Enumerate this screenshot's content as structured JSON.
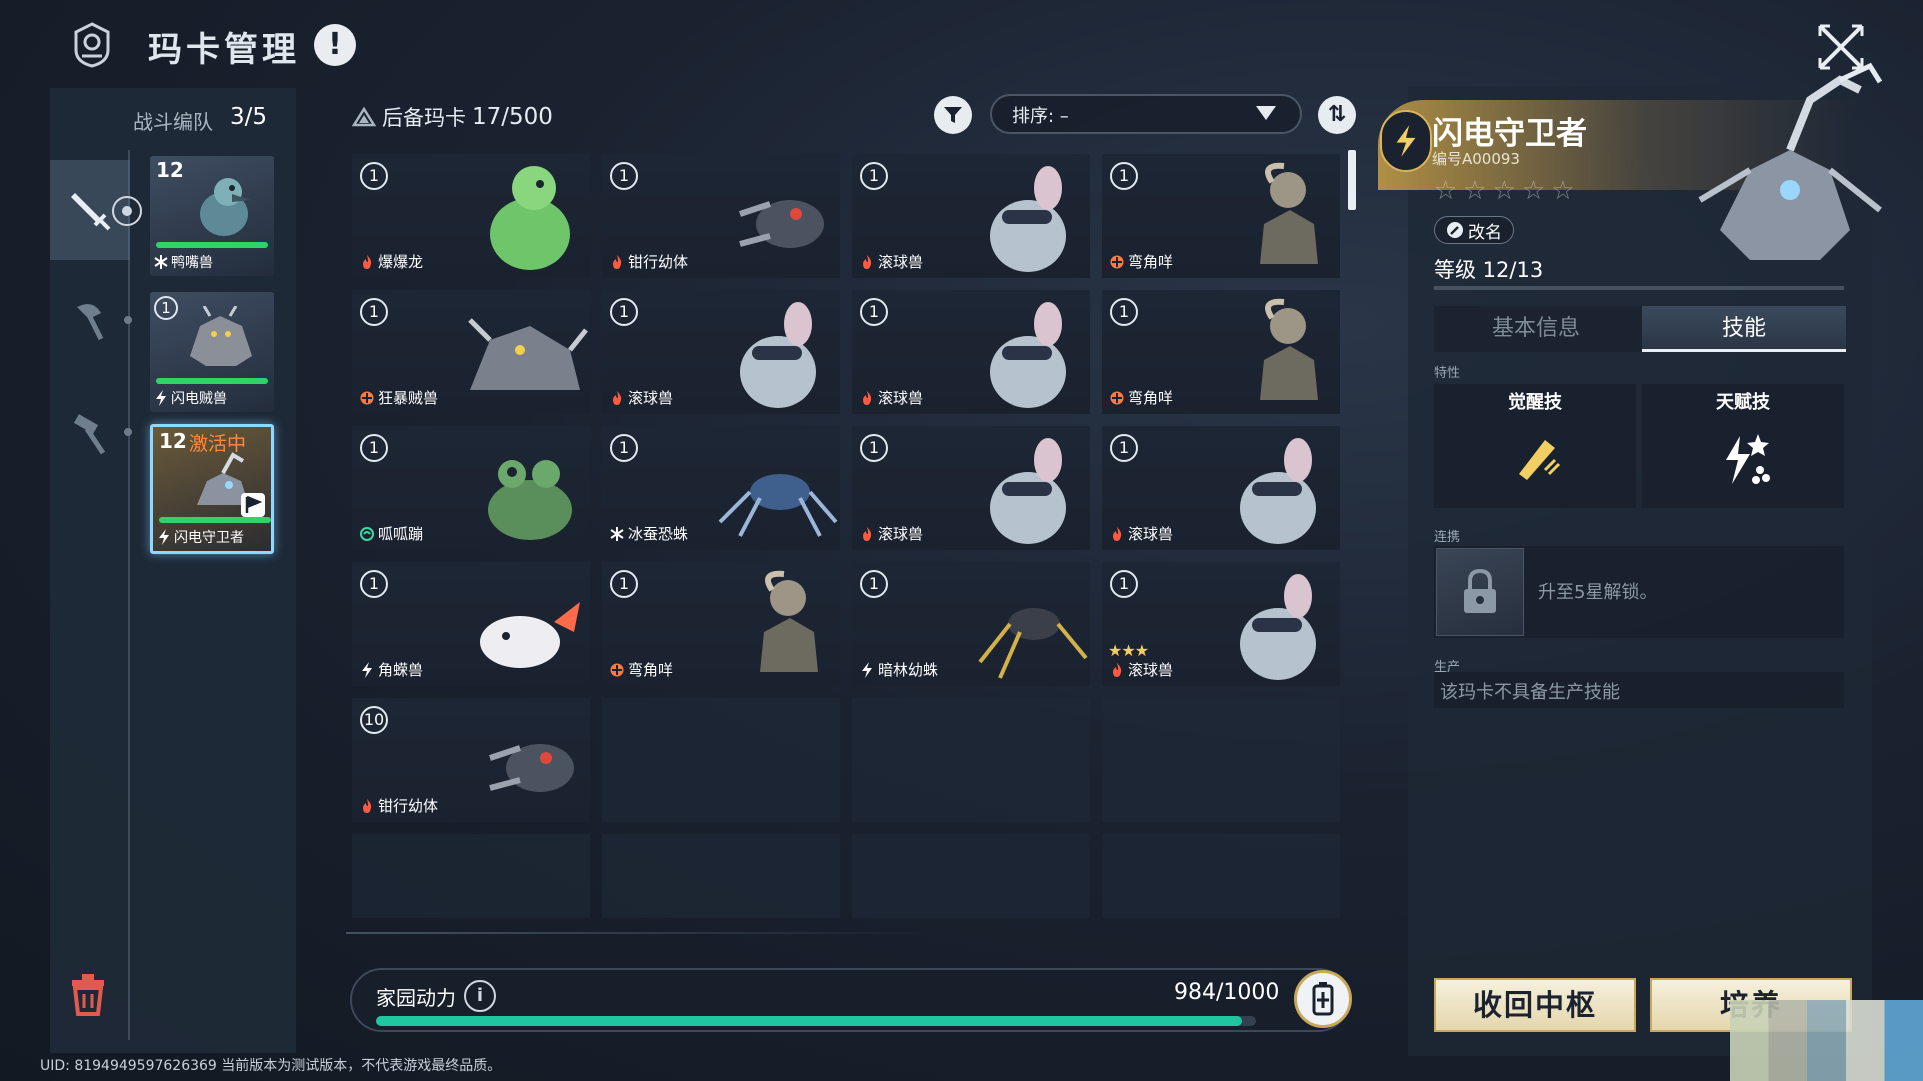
{
  "header": {
    "title": "玛卡管理",
    "alert_icon": "!"
  },
  "team": {
    "label": "战斗编队",
    "count": "3/5",
    "cards": [
      {
        "level": "12",
        "name": "鸭嘴兽",
        "element": "ice",
        "hp_fraction": 0.96,
        "active": false,
        "active_label": ""
      },
      {
        "level": "1",
        "name": "闪电贼兽",
        "element": "lightning",
        "hp_fraction": 0.96,
        "active": false,
        "active_label": ""
      },
      {
        "level": "12",
        "name": "闪电守卫者",
        "element": "lightning",
        "hp_fraction": 0.96,
        "active": true,
        "active_label": "激活中"
      }
    ]
  },
  "reserve": {
    "label": "后备玛卡",
    "count": "17/500",
    "sort_label": "排序: –",
    "cards": [
      {
        "level": "1",
        "name": "爆爆龙",
        "element": "fire",
        "stars": ""
      },
      {
        "level": "1",
        "name": "钳行幼体",
        "element": "fire",
        "stars": ""
      },
      {
        "level": "1",
        "name": "滚球兽",
        "element": "fire",
        "stars": ""
      },
      {
        "level": "1",
        "name": "弯角咩",
        "element": "cross",
        "stars": ""
      },
      {
        "level": "1",
        "name": "狂暴贼兽",
        "element": "cross",
        "stars": ""
      },
      {
        "level": "1",
        "name": "滚球兽",
        "element": "fire",
        "stars": ""
      },
      {
        "level": "1",
        "name": "滚球兽",
        "element": "fire",
        "stars": ""
      },
      {
        "level": "1",
        "name": "弯角咩",
        "element": "cross",
        "stars": ""
      },
      {
        "level": "1",
        "name": "呱呱蹦",
        "element": "wind",
        "stars": ""
      },
      {
        "level": "1",
        "name": "冰蚕恐蛛",
        "element": "ice",
        "stars": ""
      },
      {
        "level": "1",
        "name": "滚球兽",
        "element": "fire",
        "stars": ""
      },
      {
        "level": "1",
        "name": "滚球兽",
        "element": "fire",
        "stars": ""
      },
      {
        "level": "1",
        "name": "角蝾兽",
        "element": "lightning",
        "stars": ""
      },
      {
        "level": "1",
        "name": "弯角咩",
        "element": "cross",
        "stars": ""
      },
      {
        "level": "1",
        "name": "暗林幼蛛",
        "element": "lightning",
        "stars": ""
      },
      {
        "level": "1",
        "name": "滚球兽",
        "element": "fire",
        "stars": "★★★"
      },
      {
        "level": "10",
        "name": "钳行幼体",
        "element": "fire",
        "stars": ""
      }
    ]
  },
  "home_power": {
    "label": "家园动力",
    "value": "984/1000",
    "fraction": 0.984
  },
  "uid": "UID: 8194949597626369 当前版本为测试版本，不代表游戏最终品质。",
  "detail": {
    "name": "闪电守卫者",
    "id": "编号A00093",
    "stars": "☆☆☆☆☆",
    "star_count": 0,
    "rename": "改名",
    "level": "等级 12/13",
    "tabs": [
      "基本信息",
      "技能"
    ],
    "active_tab": 1,
    "trait_label": "特性",
    "awaken_skill": "觉醒技",
    "talent_skill": "天赋技",
    "link_label": "连携",
    "link_text": "升至5星解锁。",
    "production_label": "生产",
    "production_text": "该玛卡不具备生产技能",
    "btn_recall": "收回中枢",
    "btn_cultivate": "培养"
  },
  "colors": {
    "accent_gold": "#d9b45a",
    "hp_green": "#32d26a",
    "power_teal": "#1fc6a0",
    "active_orange": "#ff8a3d"
  }
}
